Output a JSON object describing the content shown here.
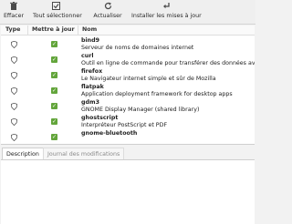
{
  "toolbar": {
    "clear": {
      "label": "Effacer",
      "icon": "trash-icon"
    },
    "select_all": {
      "label": "Tout sélectionner",
      "icon": "select-all-icon"
    },
    "refresh": {
      "label": "Actualiser",
      "icon": "refresh-icon"
    },
    "install": {
      "label": "Installer les mises à jour",
      "icon": "install-icon"
    }
  },
  "table": {
    "columns": {
      "type": "Type",
      "update": "Mettre à jour",
      "name": "Nom"
    },
    "rows": [
      {
        "name": "bind9",
        "description": "Serveur de noms de domaines internet",
        "checked": true
      },
      {
        "name": "curl",
        "description": "Outil en ligne de commande pour transférer des données avec une syntaxe URL",
        "checked": true
      },
      {
        "name": "firefox",
        "description": "Le Navigateur internet simple et sûr de Mozilla",
        "checked": true
      },
      {
        "name": "flatpak",
        "description": "Application deployment framework for desktop apps",
        "checked": true
      },
      {
        "name": "gdm3",
        "description": "GNOME Display Manager (shared library)",
        "checked": true
      },
      {
        "name": "ghostscript",
        "description": "Interpréteur PostScript et PDF",
        "checked": true
      },
      {
        "name": "gnome-bluetooth",
        "description": "",
        "checked": true
      }
    ]
  },
  "tabs": [
    "Description",
    "Journal des modifications"
  ],
  "colors": {
    "checkbox": "#63a53b"
  }
}
